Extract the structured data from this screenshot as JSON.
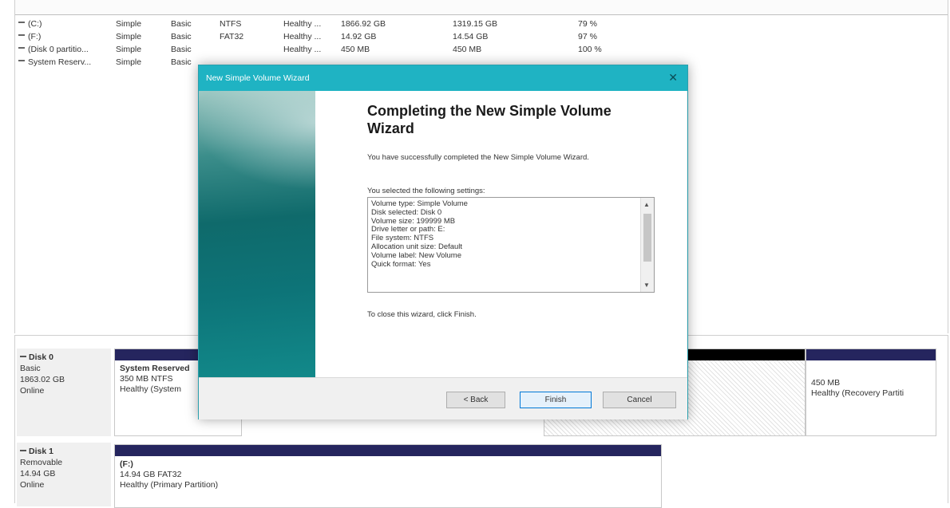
{
  "volumes": [
    {
      "name": "(C:)",
      "layout": "Simple",
      "type": "Basic",
      "fs": "NTFS",
      "status": "Healthy ...",
      "capacity": "1866.92 GB",
      "free": "1319.15 GB",
      "pct": "79 %"
    },
    {
      "name": "(F:)",
      "layout": "Simple",
      "type": "Basic",
      "fs": "FAT32",
      "status": "Healthy ...",
      "capacity": "14.92 GB",
      "free": "14.54 GB",
      "pct": "97 %"
    },
    {
      "name": "(Disk 0 partitio...",
      "layout": "Simple",
      "type": "Basic",
      "fs": "",
      "status": "Healthy ...",
      "capacity": "450 MB",
      "free": "450 MB",
      "pct": "100 %"
    },
    {
      "name": "System Reserv...",
      "layout": "Simple",
      "type": "Basic",
      "fs": "",
      "status": "",
      "capacity": "",
      "free": "",
      "pct": ""
    }
  ],
  "disks": [
    {
      "name": "Disk 0",
      "type": "Basic",
      "size": "1863.02 GB",
      "state": "Online"
    },
    {
      "name": "Disk 1",
      "type": "Removable",
      "size": "14.94 GB",
      "state": "Online"
    }
  ],
  "partitions": {
    "system_reserved": {
      "title": "System Reserved",
      "size": "350 MB NTFS",
      "status": "Healthy (System"
    },
    "recovery": {
      "size": "450 MB",
      "status": "Healthy (Recovery Partiti"
    },
    "f_drive": {
      "title": "(F:)",
      "size": "14.94 GB FAT32",
      "status": "Healthy (Primary Partition)"
    }
  },
  "wizard": {
    "title": "New Simple Volume Wizard",
    "close_glyph": "✕",
    "heading": "Completing the New Simple Volume Wizard",
    "success_text": "You have successfully completed the New Simple Volume Wizard.",
    "settings_intro": "You selected the following settings:",
    "settings": [
      "Volume type: Simple Volume",
      "Disk selected: Disk 0",
      "Volume size: 199999 MB",
      "Drive letter or path: E:",
      "File system: NTFS",
      "Allocation unit size: Default",
      "Volume label: New Volume",
      "Quick format: Yes"
    ],
    "close_text": "To close this wizard, click Finish.",
    "back_label": "< Back",
    "finish_label": "Finish",
    "cancel_label": "Cancel"
  },
  "colors": {
    "titlebar": "#1fb3c3",
    "partition_bar": "#25255e",
    "unallocated_bar": "#000000"
  }
}
